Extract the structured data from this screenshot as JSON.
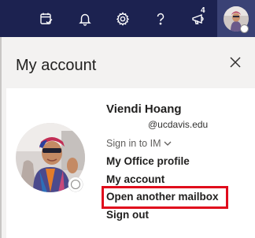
{
  "topbar": {
    "feedback_badge_count": "4",
    "icons": [
      "calendar-check-icon",
      "bell-icon",
      "gear-icon",
      "help-icon",
      "feedback-icon"
    ],
    "background": "#1c2250"
  },
  "panel": {
    "title": "My account"
  },
  "profile": {
    "name": "Viendi Hoang",
    "email": "@ucdavis.edu",
    "presence_label": "Sign in to IM",
    "links": [
      "My Office profile",
      "My account",
      "Open another mailbox",
      "Sign out"
    ],
    "highlight_color": "#e00b1c"
  }
}
